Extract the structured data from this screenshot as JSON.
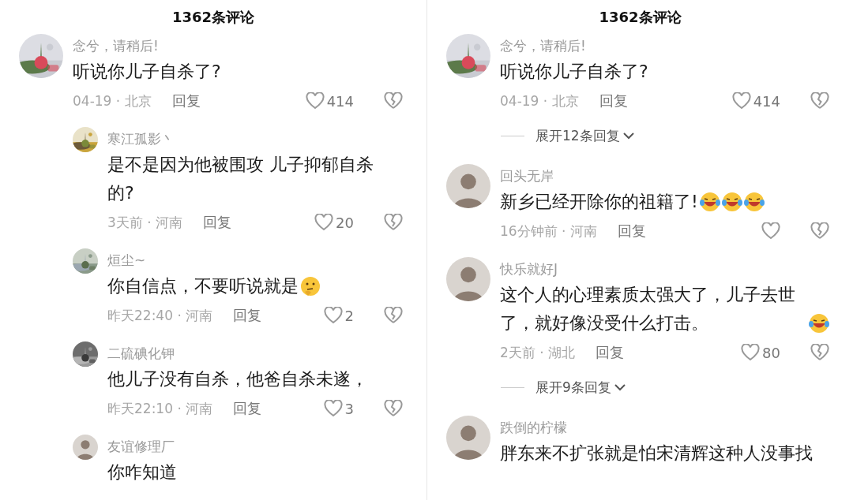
{
  "panels": [
    {
      "title": "1362条评论",
      "items": [
        {
          "kind": "comment",
          "avatar": {
            "kind": "picture"
          },
          "user": "念兮，请稍后!",
          "text": "听说你儿子自杀了?",
          "meta": "04-19 · 北京",
          "reply": "回复",
          "likes": "414",
          "liked": false
        },
        {
          "kind": "reply",
          "avatar": {
            "kind": "picture"
          },
          "user": "寒江孤影丶",
          "text": "是不是因为他被围攻 儿子抑郁自杀的?",
          "meta": "3天前 · 河南",
          "reply": "回复",
          "likes": "20",
          "liked": false
        },
        {
          "kind": "reply",
          "avatar": {
            "kind": "picture"
          },
          "user": "烜尘~",
          "text": "你自信点，不要听说就是",
          "emojis": [
            {
              "kind": "thinking"
            }
          ],
          "meta": "昨天22:40 · 河南",
          "reply": "回复",
          "likes": "2",
          "liked": false
        },
        {
          "kind": "reply",
          "avatar": {
            "kind": "picture"
          },
          "user": "二硫碘化钾",
          "text": "他儿子没有自杀，他爸自杀未遂，",
          "meta": "昨天22:10 · 河南",
          "reply": "回复",
          "likes": "3",
          "liked": false
        },
        {
          "kind": "reply",
          "avatar": {
            "kind": "person"
          },
          "user": "友谊修理厂",
          "text": "你咋知道"
        }
      ]
    },
    {
      "title": "1362条评论",
      "items": [
        {
          "kind": "comment",
          "avatar": {
            "kind": "picture"
          },
          "user": "念兮，请稍后!",
          "text": "听说你儿子自杀了?",
          "meta": "04-19 · 北京",
          "reply": "回复",
          "likes": "414",
          "liked": false
        },
        {
          "kind": "expand",
          "label": "展开12条回复"
        },
        {
          "kind": "comment",
          "avatar": {
            "kind": "person"
          },
          "user": "回头无岸",
          "text": "新乡已经开除你的祖籍了!",
          "emojis": [
            {
              "kind": "laugh"
            },
            {
              "kind": "laugh"
            },
            {
              "kind": "laugh"
            }
          ],
          "meta": "16分钟前 · 河南",
          "reply": "回复",
          "liked": false
        },
        {
          "kind": "comment",
          "avatar": {
            "kind": "person"
          },
          "user": "快乐就好J",
          "text": "这个人的心理素质太强大了，儿子去世了，就好像没受什么打击。",
          "emojis": [
            {
              "kind": "laugh"
            }
          ],
          "meta": "2天前 · 湖北",
          "reply": "回复",
          "likes": "80",
          "liked": false
        },
        {
          "kind": "expand",
          "label": "展开9条回复"
        },
        {
          "kind": "comment",
          "avatar": {
            "kind": "person"
          },
          "user": "跌倒的柠檬",
          "text": "胖东来不扩张就是怕宋清辉这种人没事找"
        }
      ]
    }
  ]
}
